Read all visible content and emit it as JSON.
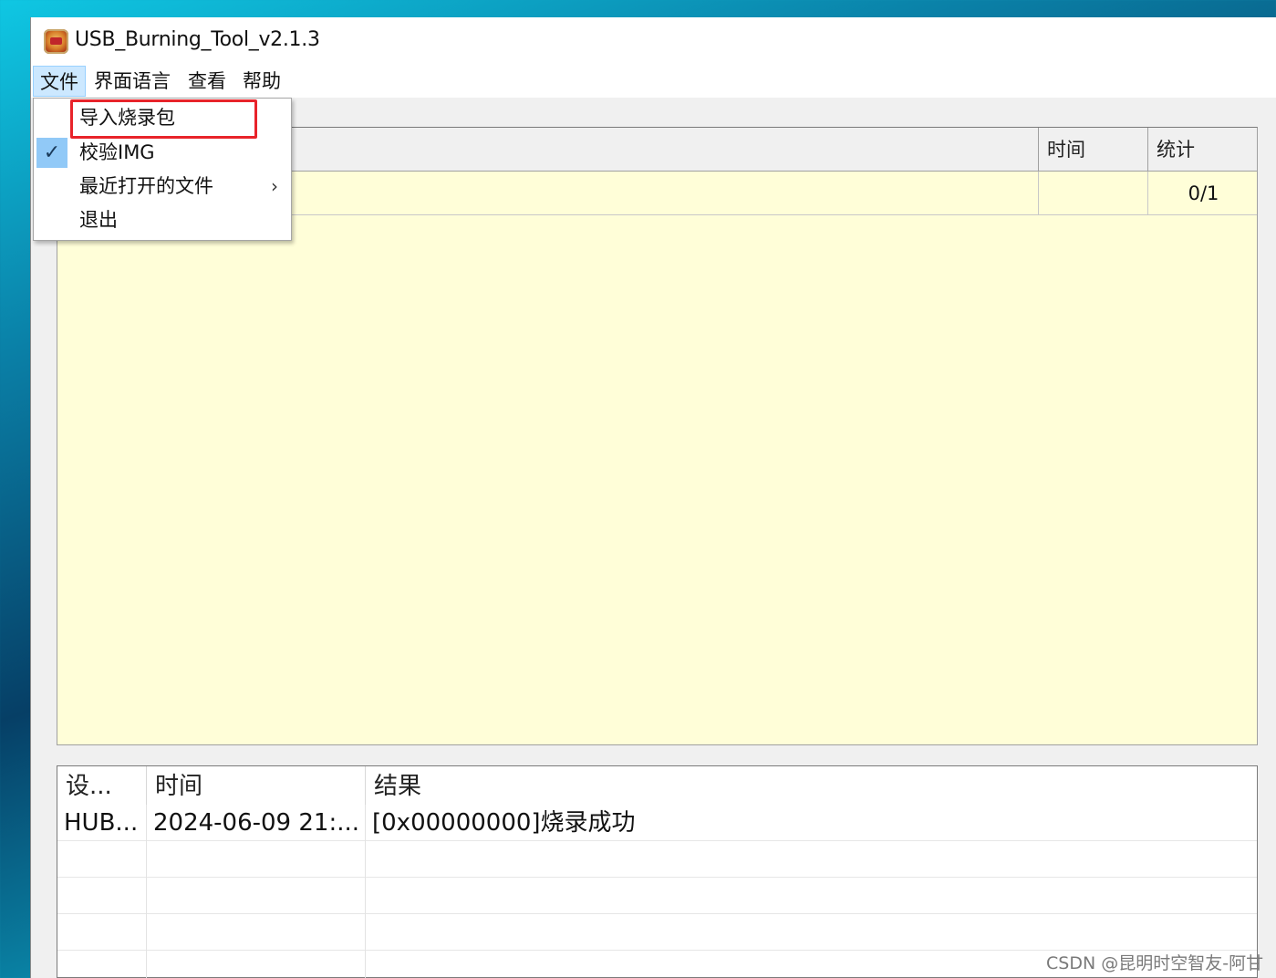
{
  "window": {
    "title": "USB_Burning_Tool_v2.1.3"
  },
  "menubar": {
    "items": [
      "文件",
      "界面语言",
      "查看",
      "帮助"
    ]
  },
  "file_menu": {
    "items": [
      {
        "label": "导入烧录包"
      },
      {
        "label": "校验IMG",
        "checked": true
      },
      {
        "label": "最近打开的文件",
        "submenu_arrow": "›"
      },
      {
        "label": "退出"
      }
    ],
    "check_icon": "✓"
  },
  "device_table": {
    "headers": [
      "",
      "时间",
      "统计"
    ],
    "rows": [
      {
        "device": "",
        "time": "",
        "count": "0/1"
      }
    ]
  },
  "log_table": {
    "headers": [
      "设...",
      "时间",
      "结果"
    ],
    "rows": [
      {
        "device": "HUB...",
        "time": "2024-06-09 21:...",
        "result": "[0x00000000]烧录成功"
      }
    ]
  },
  "watermark": "CSDN @昆明时空智友-阿甘",
  "colors": {
    "highlight": "#e8232a",
    "panel_background": "#fffed8",
    "menu_active": "#cce8ff"
  }
}
